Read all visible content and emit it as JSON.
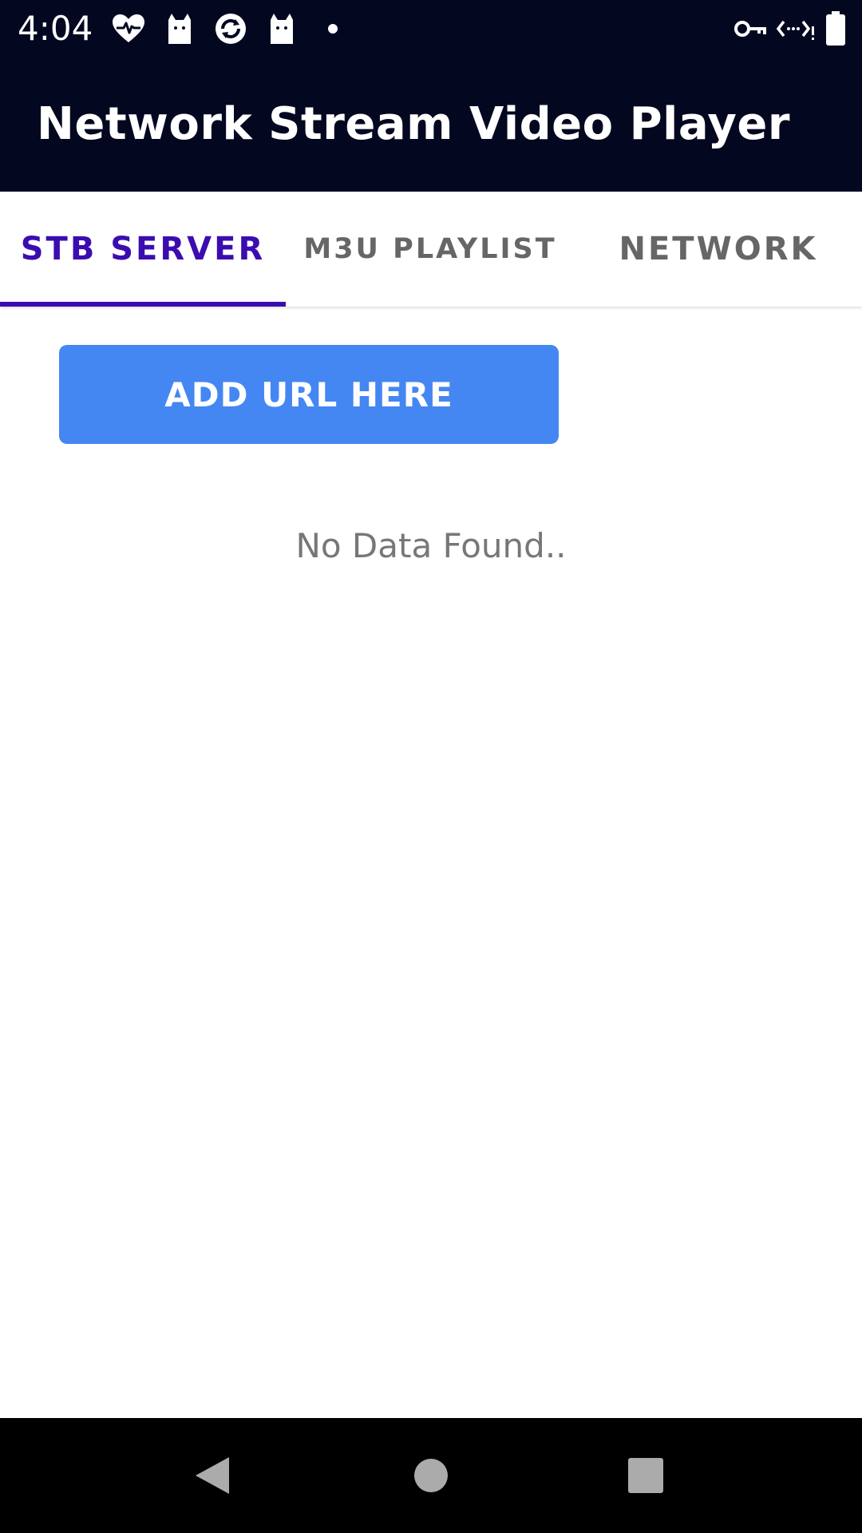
{
  "status_bar": {
    "time": "4:04",
    "left_icons": [
      "heart-monitor-icon",
      "cat-icon",
      "sync-badge-icon",
      "cat-icon",
      "notification-dot-icon"
    ],
    "right_icons": [
      "vpn-key-icon",
      "data-saver-icon",
      "battery-icon"
    ]
  },
  "app_bar": {
    "title": "Network Stream Video Player"
  },
  "tabs": [
    {
      "label": "STB SERVER",
      "selected": true
    },
    {
      "label": "M3U PLAYLIST",
      "selected": false
    },
    {
      "label": "NETWORK",
      "selected": false
    }
  ],
  "main": {
    "add_button_label": "ADD URL HERE",
    "empty_message": "No Data Found.."
  },
  "nav_bar": {
    "buttons": [
      "back-icon",
      "home-icon",
      "recents-icon"
    ]
  },
  "colors": {
    "app_bar_bg": "#030720",
    "tab_selected": "#3b0db0",
    "tab_unselected": "#666666",
    "button_bg": "#4487f2",
    "empty_text": "#777777"
  }
}
